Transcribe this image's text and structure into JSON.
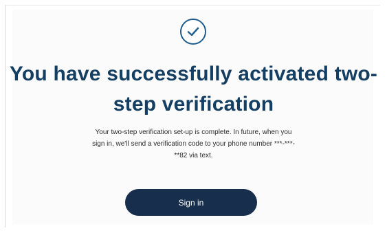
{
  "page": {
    "icon": "check-circle-icon",
    "headline": "You have successfully activated two-step verification",
    "message": "Your two-step verification set-up is complete. In future, when you sign in, we'll send a verification code to your phone number ***-***-**82 via text.",
    "button_label": "Sign in"
  },
  "colors": {
    "accent": "#1f5e8f",
    "headline": "#143f63",
    "button_bg": "#172e4d",
    "button_text": "#ffffff"
  }
}
